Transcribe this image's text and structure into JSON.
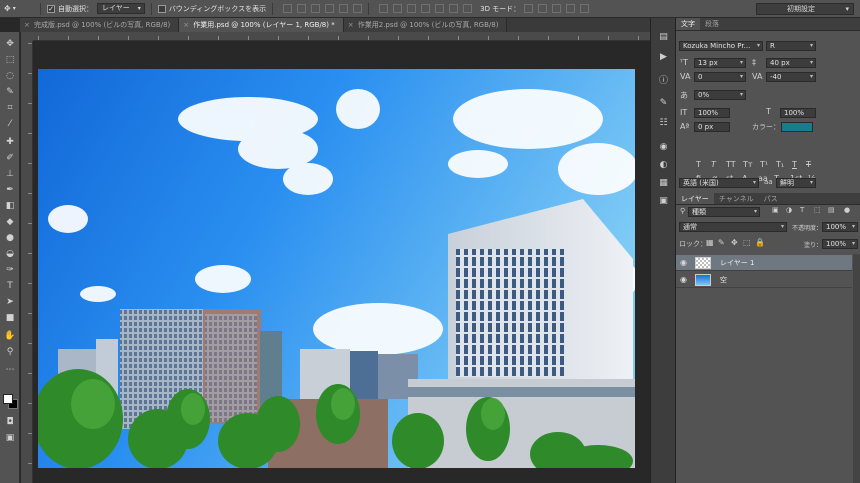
{
  "options_bar": {
    "auto_select_label": "自動選択：",
    "auto_select_value": "レイヤー",
    "bounding_box_label": "バウンディングボックスを表示",
    "mode_3d_label": "3D モード：",
    "workspace": "初期設定"
  },
  "tabs": [
    {
      "label": "完成版.psd @ 100% (ビルの写真, RGB/8)",
      "active": false
    },
    {
      "label": "作業用.psd @ 100% (レイヤー 1, RGB/8) *",
      "active": true
    },
    {
      "label": "作業用2.psd @ 100% (ビルの写真, RGB/8)",
      "active": false
    }
  ],
  "character": {
    "tabs": [
      "文字",
      "段落"
    ],
    "font_family": "Kozuka Mincho Pr...",
    "font_style": "R",
    "font_size": "13 px",
    "leading": "40 px",
    "kerning": "0",
    "tracking": "-40",
    "tsume": "0%",
    "vertical_scale": "100%",
    "horizontal_scale": "100%",
    "baseline_shift": "0 px",
    "color_label": "カラー：",
    "color": "#177c8f",
    "language": "英語 (米国)",
    "antialias": "鮮明",
    "aa_label": "aa"
  },
  "layers_panel": {
    "tabs": [
      "レイヤー",
      "チャンネル",
      "パス"
    ],
    "filter": "種類",
    "blend_mode": "通常",
    "opacity_label": "不透明度：",
    "opacity": "100%",
    "lock_label": "ロック：",
    "fill_label": "塗り：",
    "fill": "100%",
    "layers": [
      {
        "name": "レイヤー 1",
        "selected": true
      },
      {
        "name": "空",
        "selected": false
      }
    ]
  }
}
